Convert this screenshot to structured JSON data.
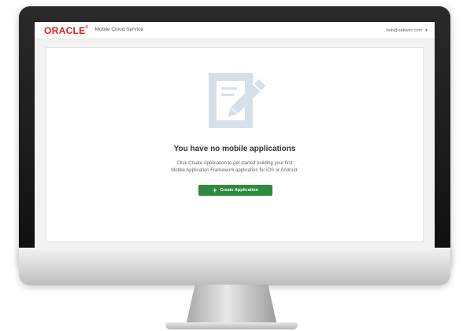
{
  "header": {
    "logo_text": "ORACLE",
    "product_name": "Mobile Cloud Service",
    "user_email": "bob@oakwex.com",
    "user_menu_icon": "chevron-down-icon"
  },
  "empty_state": {
    "icon": "edit-document-icon",
    "title": "You have no mobile applications",
    "description_line1": "Click Create Application to get started building your first",
    "description_line2": "Mobile Application Framework application for iOS or Android.",
    "button_icon": "plus-icon",
    "button_label": "Create Application"
  },
  "colors": {
    "brand_red": "#e0201b",
    "button_green": "#2d8a3e",
    "icon_tint": "#d6e0ea"
  }
}
